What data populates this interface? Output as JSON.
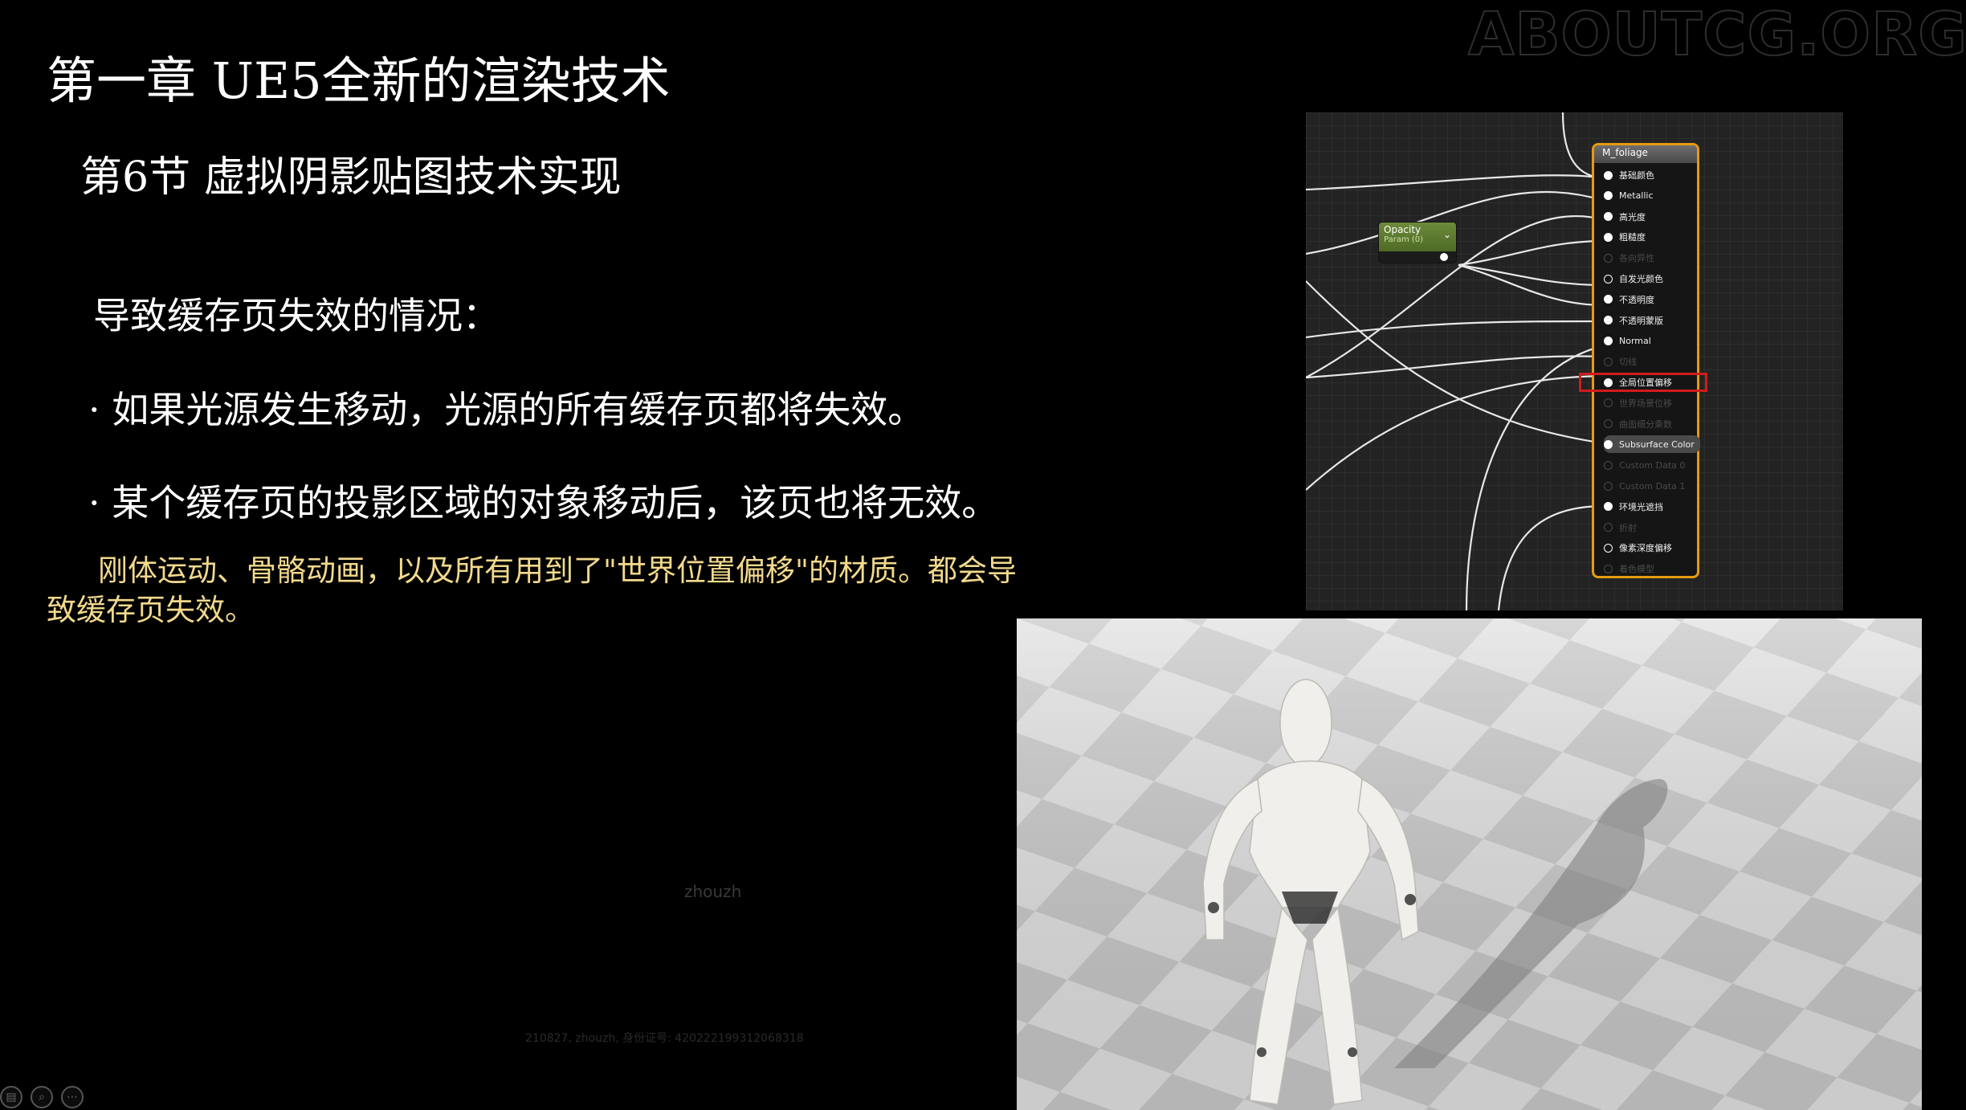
{
  "watermark": "ABOUTCG.ORG",
  "slide": {
    "title": "第一章 UE5全新的渲染技术",
    "subtitle": "第6节 虚拟阴影贴图技术实现",
    "intro": "导致缓存页失效的情况：",
    "bullets": [
      "· 如果光源发生移动，光源的所有缓存页都将失效。",
      "· 某个缓存页的投影区域的对象移动后，该页也将无效。"
    ],
    "note": "刚体运动、骨骼动画，以及所有用到了\"世界位置偏移\"的材质。都会导致缓存页失效。",
    "ghost_name": "zhouzh",
    "ghost_id": "210827, zhouzh, 身份证号: 420222199312068318"
  },
  "graph": {
    "opacity_node": {
      "title": "Opacity",
      "sub": "Param (0)"
    },
    "material_node": {
      "title": "M_foliage",
      "pins": [
        {
          "label": "基础颜色",
          "state": "active"
        },
        {
          "label": "Metallic",
          "state": "active"
        },
        {
          "label": "高光度",
          "state": "active"
        },
        {
          "label": "粗糙度",
          "state": "active"
        },
        {
          "label": "各向异性",
          "state": "dim"
        },
        {
          "label": "自发光颜色",
          "state": "hollow"
        },
        {
          "label": "不透明度",
          "state": "active"
        },
        {
          "label": "不透明蒙版",
          "state": "active"
        },
        {
          "label": "Normal",
          "state": "active"
        },
        {
          "label": "切线",
          "state": "dim"
        },
        {
          "label": "全局位置偏移",
          "state": "active"
        },
        {
          "label": "世界场景位移",
          "state": "dim"
        },
        {
          "label": "曲面细分乘数",
          "state": "dim"
        },
        {
          "label": "Subsurface Color",
          "state": "highlight"
        },
        {
          "label": "Custom Data 0",
          "state": "dim"
        },
        {
          "label": "Custom Data 1",
          "state": "dim"
        },
        {
          "label": "环境光遮挡",
          "state": "active"
        },
        {
          "label": "折射",
          "state": "dim"
        },
        {
          "label": "像素深度偏移",
          "state": "hollow"
        },
        {
          "label": "着色模型",
          "state": "dim"
        }
      ]
    }
  },
  "toolbar": {
    "icons": [
      "slides-icon",
      "zoom-icon",
      "more-icon"
    ]
  },
  "colors": {
    "note_text": "#f2d98c",
    "node_border": "#e69a10",
    "highlight_box": "#d21b1b"
  }
}
